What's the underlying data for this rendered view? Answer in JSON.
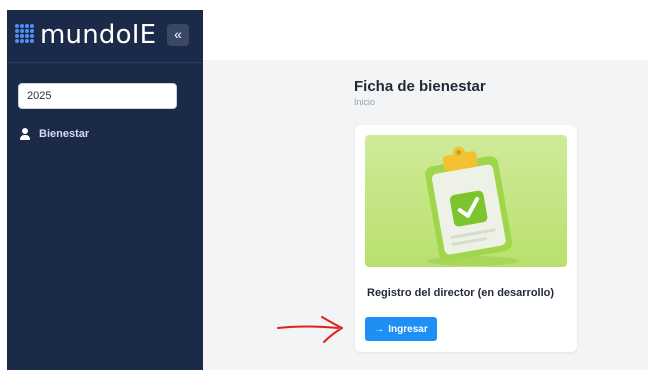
{
  "sidebar": {
    "brand_name": "mundoIE",
    "collapse_glyph": "«",
    "year_value": "2025",
    "items": [
      {
        "label": "Bienestar",
        "icon": "user-icon"
      }
    ]
  },
  "header": {
    "title": "Ficha de bienestar",
    "breadcrumb": "Inicio"
  },
  "card": {
    "image_icon": "clipboard-check-icon",
    "title": "Registro del director (en desarrollo)",
    "button_label": "Ingresar",
    "button_icon": "arrow-right-icon"
  },
  "annotation": {
    "icon": "red-arrow-annotation"
  },
  "colors": {
    "sidebar_bg": "#1c2a4a",
    "accent": "#1e90f5",
    "card_image_bg": "#c4e584",
    "annotation": "#e02020"
  }
}
